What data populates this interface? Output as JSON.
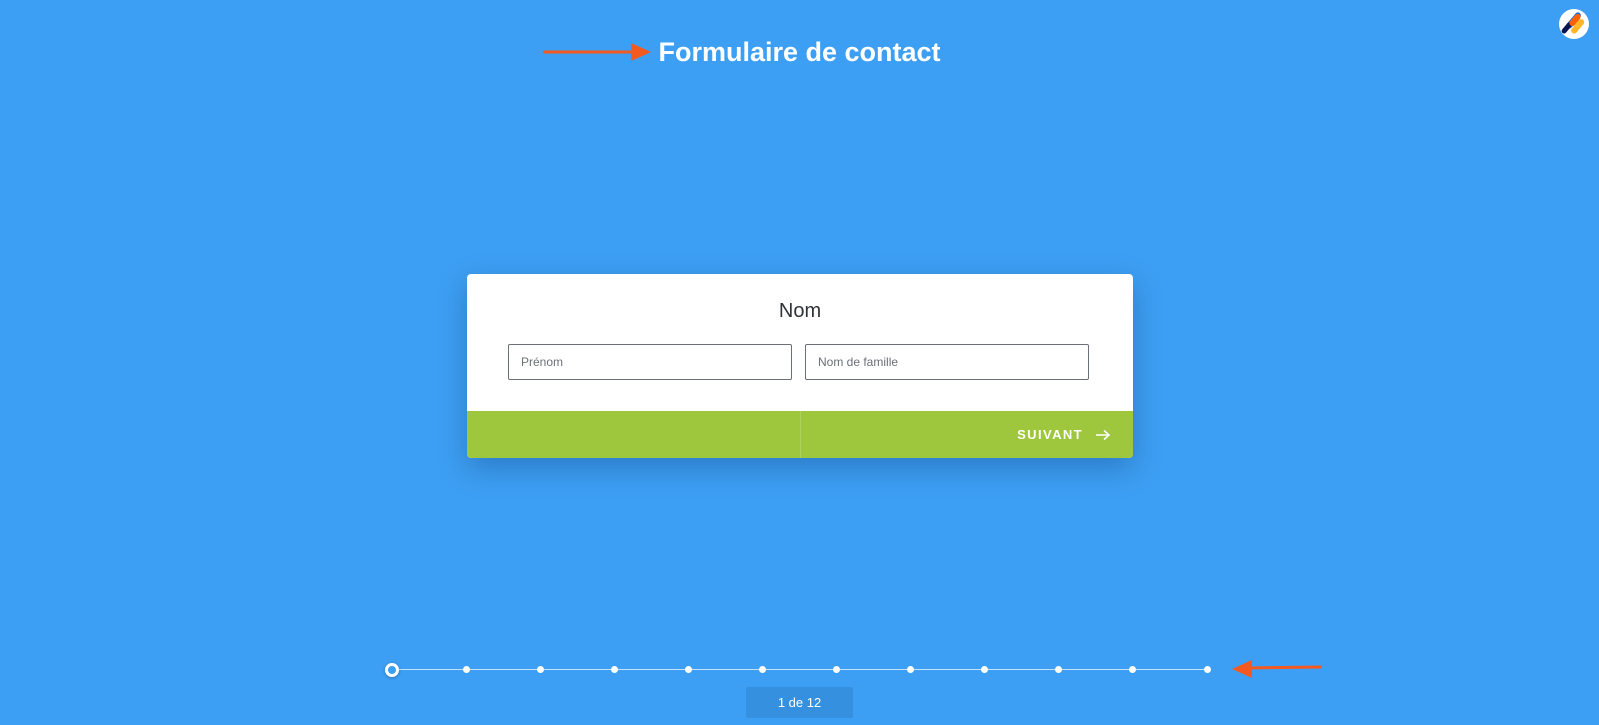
{
  "header": {
    "title": "Formulaire de contact"
  },
  "question": {
    "label": "Nom",
    "fields": [
      {
        "placeholder": "Prénom",
        "value": ""
      },
      {
        "placeholder": "Nom de famille",
        "value": ""
      }
    ]
  },
  "navigation": {
    "next_label": "SUIVANT"
  },
  "progress": {
    "current_step": 1,
    "total_steps": 12,
    "counter_text": "1 de 12"
  },
  "icons": {
    "header_arrow": "arrow-right-icon",
    "progress_arrow": "arrow-left-icon",
    "next_arrow": "arrow-right-icon",
    "logo": "jotform-logo-icon"
  },
  "colors": {
    "background": "#3d9ff3",
    "card": "#ffffff",
    "footer": "#9ec73d",
    "annotation_arrow": "#f25a1f",
    "counter_bg": "#3591e0"
  }
}
